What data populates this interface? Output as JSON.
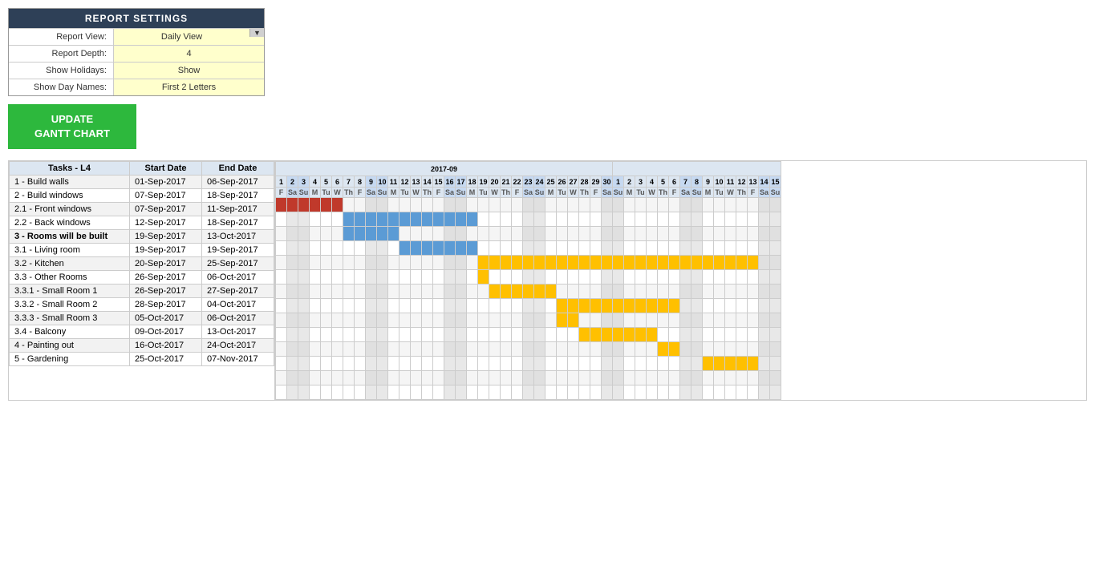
{
  "settings": {
    "title": "REPORT SETTINGS",
    "fields": [
      {
        "label": "Report View:",
        "value": "Daily View",
        "hasArrow": true
      },
      {
        "label": "Report Depth:",
        "value": "4",
        "hasArrow": false
      },
      {
        "label": "Show Holidays:",
        "value": "Show",
        "hasArrow": false
      },
      {
        "label": "Show Day Names:",
        "value": "First 2 Letters",
        "hasArrow": false
      }
    ]
  },
  "button": {
    "label": "UPDATE\nGANTT CHART"
  },
  "gantt": {
    "headers": {
      "task": "Tasks - L4",
      "start": "Start Date",
      "end": "End Date"
    },
    "month_label": "2017-09",
    "tasks": [
      {
        "name": "1 - Build walls",
        "start": "01-Sep-2017",
        "end": "06-Sep-2017",
        "bold": false,
        "color": "red",
        "bar_start": 1,
        "bar_len": 6
      },
      {
        "name": "2 - Build windows",
        "start": "07-Sep-2017",
        "end": "18-Sep-2017",
        "bold": false,
        "color": "blue",
        "bar_start": 7,
        "bar_len": 12
      },
      {
        "name": "2.1 - Front windows",
        "start": "07-Sep-2017",
        "end": "11-Sep-2017",
        "bold": false,
        "color": "blue",
        "bar_start": 7,
        "bar_len": 5
      },
      {
        "name": "2.2 - Back windows",
        "start": "12-Sep-2017",
        "end": "18-Sep-2017",
        "bold": false,
        "color": "blue",
        "bar_start": 12,
        "bar_len": 7
      },
      {
        "name": "3 - Rooms will be built",
        "start": "19-Sep-2017",
        "end": "13-Oct-2017",
        "bold": true,
        "color": "yellow",
        "bar_start": 19,
        "bar_len": 25
      },
      {
        "name": "3.1 - Living room",
        "start": "19-Sep-2017",
        "end": "19-Sep-2017",
        "bold": false,
        "color": "yellow",
        "bar_start": 19,
        "bar_len": 1
      },
      {
        "name": "3.2 - Kitchen",
        "start": "20-Sep-2017",
        "end": "25-Sep-2017",
        "bold": false,
        "color": "yellow",
        "bar_start": 20,
        "bar_len": 6
      },
      {
        "name": "3.3 - Other Rooms",
        "start": "26-Sep-2017",
        "end": "06-Oct-2017",
        "bold": false,
        "color": "yellow",
        "bar_start": 26,
        "bar_len": 11
      },
      {
        "name": "3.3.1 - Small Room 1",
        "start": "26-Sep-2017",
        "end": "27-Sep-2017",
        "bold": false,
        "color": "yellow",
        "bar_start": 26,
        "bar_len": 2
      },
      {
        "name": "3.3.2 - Small Room 2",
        "start": "28-Sep-2017",
        "end": "04-Oct-2017",
        "bold": false,
        "color": "yellow",
        "bar_start": 28,
        "bar_len": 7
      },
      {
        "name": "3.3.3 - Small Room 3",
        "start": "05-Oct-2017",
        "end": "06-Oct-2017",
        "bold": false,
        "color": "yellow",
        "bar_start": 35,
        "bar_len": 2
      },
      {
        "name": "3.4 - Balcony",
        "start": "09-Oct-2017",
        "end": "13-Oct-2017",
        "bold": false,
        "color": "yellow",
        "bar_start": 39,
        "bar_len": 5
      },
      {
        "name": "4 - Painting out",
        "start": "16-Oct-2017",
        "end": "24-Oct-2017",
        "bold": false,
        "color": "",
        "bar_start": 0,
        "bar_len": 0
      },
      {
        "name": "5 - Gardening",
        "start": "25-Oct-2017",
        "end": "07-Nov-2017",
        "bold": false,
        "color": "",
        "bar_start": 0,
        "bar_len": 0
      }
    ]
  }
}
